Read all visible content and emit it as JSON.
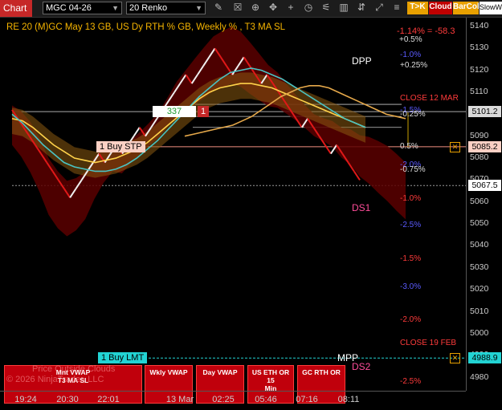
{
  "toolbar": {
    "chart_tab": "Chart",
    "instrument": "MGC 04-26",
    "period": "20 Renko",
    "icons": [
      "pencil-icon",
      "magnifier-icon",
      "zoom-in-icon",
      "crosshair-icon",
      "cursor-icon",
      "clock-icon",
      "indicator-icon",
      "strategy-icon",
      "instrument-icon",
      "scroll-icon",
      "properties-icon"
    ],
    "tok_label": "T>K",
    "cloud_label": "Cloud",
    "barcol_label": "BarCol",
    "slowwave_label": "SlowWa",
    "colors": {
      "tok": "#e8a000",
      "cloud": "#c00000",
      "barcol": "#e8a000"
    }
  },
  "chart_header": {
    "title": "RE 20  (M)GC May 13 GB, US Dy RTH % GB, Weekly % , T3 MA SL",
    "change": "-1.14% = -58.3",
    "change_pct": "+0.5%"
  },
  "annotations": [
    {
      "text": "DPP",
      "price": 5124,
      "color": "#ffffff"
    },
    {
      "text": "-1.0%",
      "price": 5127,
      "color": "#5b5bff"
    },
    {
      "text": "+0.25%",
      "price": 5122,
      "color": "#dddddd"
    },
    {
      "text": "CLOSE 12 MAR",
      "price": 5107,
      "color": "#ff3b3b"
    },
    {
      "text": "-1.5%",
      "price": 5101.6,
      "color": "#5b5bff"
    },
    {
      "text": "-0.25%",
      "price": 5099.8,
      "color": "#dddddd"
    },
    {
      "text": "0.5%",
      "price": 5085.2,
      "color": "#dddddd"
    },
    {
      "text": "-2.0%",
      "price": 5076.7,
      "color": "#5b5bff"
    },
    {
      "text": "-0.75%",
      "price": 5074.6,
      "color": "#dddddd"
    },
    {
      "text": "-1.0%",
      "price": 5061.5,
      "color": "#ff3b3b"
    },
    {
      "text": "DS1",
      "price": 5057,
      "color": "#ff4d9a"
    },
    {
      "text": "-2.5%",
      "price": 5049.2,
      "color": "#5b5bff"
    },
    {
      "text": "-1.5%",
      "price": 5034,
      "color": "#ff3b3b"
    },
    {
      "text": "-3.0%",
      "price": 5021,
      "color": "#5b5bff"
    },
    {
      "text": "-2.0%",
      "price": 5006,
      "color": "#ff3b3b"
    },
    {
      "text": "CLOSE 19 FEB",
      "price": 4995.5,
      "color": "#ff3b3b"
    },
    {
      "text": "MPP",
      "price": 4988.5,
      "color": "#ffffff"
    },
    {
      "text": "DS2",
      "price": 4984.7,
      "color": "#ff4d9a"
    },
    {
      "text": "-2.5%",
      "price": 4978.2,
      "color": "#ff3b3b"
    }
  ],
  "orders": [
    {
      "label": "1 Buy STP",
      "price": 5085.2
    },
    {
      "label": "1 Buy LMT",
      "price": 4988.9
    }
  ],
  "position": {
    "qty": "337",
    "flag": "1",
    "price": 5101.2
  },
  "nav_buttons": [
    {
      "line1": "Mnt VWAP",
      "line2": "T3 MA SL"
    },
    {
      "line1": "Wkly VWAP",
      "line2": ""
    },
    {
      "line1": "Day VWAP",
      "line2": ""
    },
    {
      "line1": "US ETH OR 15",
      "line2": "Min"
    },
    {
      "line1": "GC RTH OR",
      "line2": ""
    }
  ],
  "watermark": {
    "line1": "Price Outside Clouds",
    "line2": "© 2026 NinjaTrader, LLC"
  },
  "price_boxes": [
    {
      "text": "5101.2",
      "price": 5101.2,
      "bg": "#d9d9d9"
    },
    {
      "text": "5085.2",
      "price": 5085.2,
      "bg": "#fbd0c4"
    },
    {
      "text": "5067.5",
      "price": 5067.5,
      "bg": "#ffffff"
    },
    {
      "text": "4988.9",
      "price": 4988.9,
      "bg": "#22d3d3"
    }
  ],
  "chart_data": {
    "type": "line",
    "title": "RE 20  (M)GC May 13 GB, US Dy RTH % GB, Weekly % , T3 MA SL",
    "y_axis": {
      "ticks": [
        5140,
        5130,
        5120,
        5110,
        5100,
        5090,
        5080,
        5070,
        5060,
        5050,
        5040,
        5030,
        5020,
        5010,
        5000,
        4990,
        4980
      ],
      "range": [
        4974,
        5144
      ]
    },
    "x_axis": {
      "ticks": [
        "19:24",
        "20:30",
        "22:01",
        "13 Mar",
        "02:25",
        "05:46",
        "07:16",
        "08:11"
      ]
    },
    "series": [
      {
        "values": [
          5098,
          5094,
          5088,
          5080,
          5070,
          5064,
          5060,
          5062,
          5066,
          5074,
          5080,
          5084,
          5082,
          5086,
          5090,
          5094,
          5098,
          5104,
          5110,
          5114,
          5118,
          5122,
          5126,
          5128,
          5130,
          5128,
          5124,
          5120,
          5116,
          5114,
          5110,
          5106,
          5102,
          5098,
          5096,
          5094,
          5090,
          5088,
          5084,
          5082,
          5079,
          5076,
          5072,
          5068
        ]
      },
      {
        "values": [
          5098,
          5097,
          5094,
          5090,
          5086,
          5083,
          5080,
          5079,
          5078,
          5079,
          5080,
          5082,
          5084,
          5087,
          5091,
          5095,
          5099,
          5103,
          5107,
          5110,
          5112,
          5113,
          5114,
          5114,
          5113,
          5112,
          5110,
          5108,
          5106,
          5104,
          5102,
          5100,
          5098,
          5096,
          5094
        ]
      },
      {
        "values": [
          5100,
          5096,
          5091,
          5086,
          5082,
          5078,
          5076,
          5075,
          5074,
          5074,
          5075,
          5077,
          5080,
          5084,
          5088,
          5093,
          5098,
          5103,
          5108,
          5112,
          5116,
          5119,
          5120,
          5121,
          5120,
          5118,
          5116,
          5113,
          5110,
          5107,
          5104,
          5101,
          5098,
          5096,
          5094
        ]
      },
      {
        "values": [
          5090,
          5091,
          5092,
          5093,
          5094,
          5095,
          5097,
          5099,
          5102,
          5105,
          5108,
          5110,
          5112,
          5113,
          5113,
          5112,
          5110,
          5108,
          5106,
          5104,
          5102,
          5100,
          5099,
          5098
        ]
      }
    ]
  }
}
